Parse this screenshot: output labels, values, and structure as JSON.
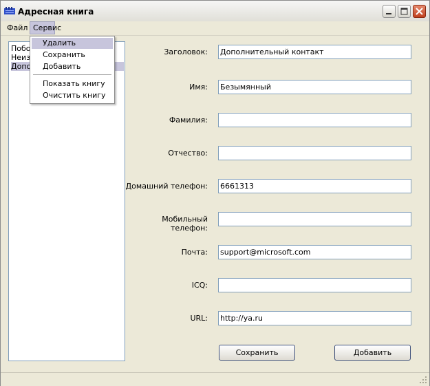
{
  "window": {
    "title": "Адресная книга"
  },
  "menubar": {
    "file": "Файл",
    "service": "Сервис"
  },
  "menu_service": {
    "items": [
      "Удалить",
      "Сохранить",
      "Добавить"
    ],
    "items2": [
      "Показать книгу",
      "Очистить книгу"
    ],
    "highlighted": "Удалить"
  },
  "contacts_list": {
    "items": [
      "Побоч",
      "Неизв",
      "Допо"
    ],
    "selected_index": 2
  },
  "form": {
    "fields": [
      {
        "label": "Заголовок:",
        "value": "Дополнительный контакт"
      },
      {
        "label": "Имя:",
        "value": "Безымянный"
      },
      {
        "label": "Фамилия:",
        "value": ""
      },
      {
        "label": "Отчество:",
        "value": ""
      },
      {
        "label": "Домашний телефон:",
        "value": "6661313"
      },
      {
        "label": "Мобильный телефон:",
        "value": ""
      },
      {
        "label": "Почта:",
        "value": "support@microsoft.com"
      },
      {
        "label": "ICQ:",
        "value": ""
      },
      {
        "label": "URL:",
        "value": "http://ya.ru"
      }
    ],
    "save_label": "Сохранить",
    "add_label": "Добавить"
  },
  "colors": {
    "accent_highlight": "#c7c5dc",
    "window_bg": "#ece9d8",
    "close_button": "#c0411e"
  },
  "icons": [
    "app-icon",
    "minimize-icon",
    "maximize-icon",
    "close-icon",
    "resize-grip-icon"
  ]
}
